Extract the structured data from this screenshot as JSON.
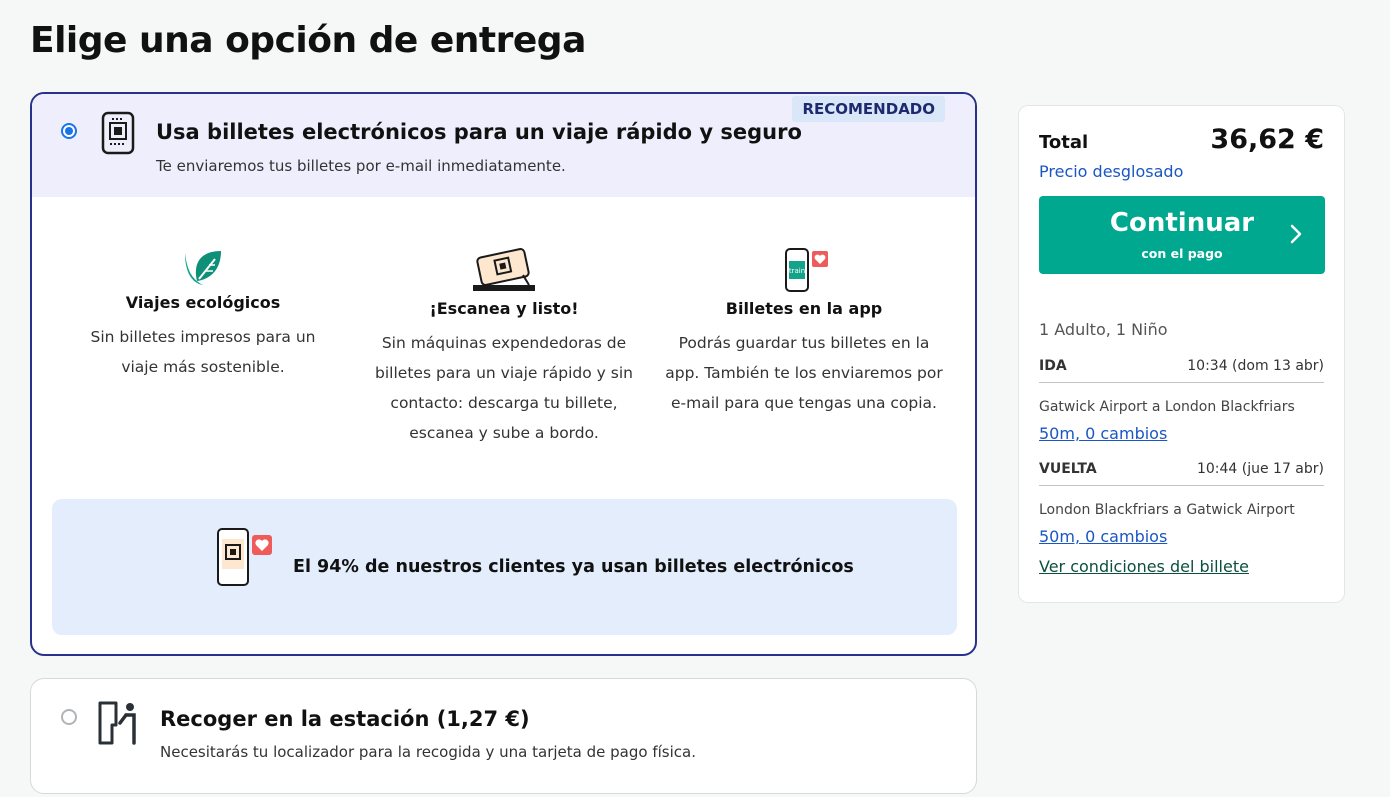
{
  "page": {
    "title": "Elige una opción de entrega"
  },
  "eticket": {
    "badge": "RECOMENDADO",
    "title": "Usa billetes electrónicos para un viaje rápido y seguro",
    "desc": "Te enviaremos tus billetes por e-mail inmediatamente.",
    "benefits": [
      {
        "title": "Viajes ecológicos",
        "text": "Sin billetes impresos para un viaje más sostenible."
      },
      {
        "title": "¡Escanea y listo!",
        "text": "Sin máquinas expendedoras de billetes para un viaje rápido y sin contacto: descarga tu billete, escanea y sube a bordo."
      },
      {
        "title": "Billetes en la app",
        "text": "Podrás guardar tus billetes en la app. También te los enviaremos por e-mail para que tengas una copia."
      }
    ],
    "banner": "El 94% de nuestros clientes ya usan billetes electrónicos",
    "app_icon_label": "train"
  },
  "station": {
    "title": "Recoger en la estación (1,27 €)",
    "desc": "Necesitarás tu localizador para la recogida y una tarjeta de pago física."
  },
  "summary": {
    "total_label": "Total",
    "total_price": "36,62 €",
    "price_breakdown": "Precio desglosado",
    "continue_label": "Continuar",
    "continue_sub": "con el pago",
    "passengers": "1 Adulto, 1 Niño",
    "outbound": {
      "label": "IDA",
      "time": "10:34 (dom 13 abr)",
      "route": "Gatwick Airport a London Blackfriars",
      "details": "50m, 0 cambios"
    },
    "return": {
      "label": "VUELTA",
      "time": "10:44 (jue 17 abr)",
      "route": "London Blackfriars a Gatwick Airport",
      "details": "50m, 0 cambios"
    },
    "conditions": "Ver condiciones del billete"
  },
  "colors": {
    "accent": "#00a88f",
    "selected_border": "#28328c",
    "link": "#1a56c4",
    "banner_bg": "#e3edfb",
    "header_bg": "#efeefd"
  },
  "icons": [
    "mobile-ticket-icon",
    "leaf-icon",
    "scan-ticket-icon",
    "app-ticket-icon",
    "heart-icon",
    "station-pickup-icon",
    "chevron-right-icon"
  ]
}
